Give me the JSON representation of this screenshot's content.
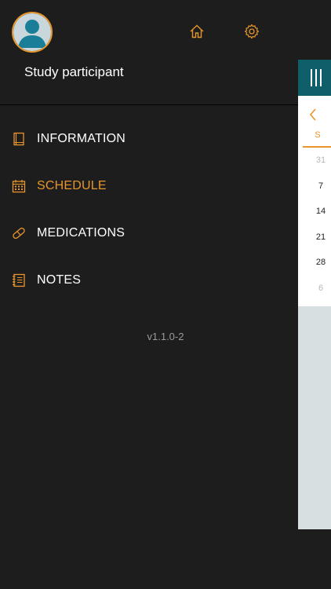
{
  "colors": {
    "accent": "#e8952b",
    "background": "#1d1d1d",
    "calendar_header": "#0f5f6b"
  },
  "header": {
    "avatar_icon": "user-avatar-icon",
    "home_icon": "home-icon",
    "settings_icon": "gear-icon",
    "username": "Study participant"
  },
  "menu": {
    "items": [
      {
        "label": "INFORMATION",
        "icon": "book-icon",
        "active": false
      },
      {
        "label": "SCHEDULE",
        "icon": "calendar-icon",
        "active": true
      },
      {
        "label": "MEDICATIONS",
        "icon": "pill-icon",
        "active": false
      },
      {
        "label": "NOTES",
        "icon": "notepad-icon",
        "active": false
      }
    ]
  },
  "version": "v1.1.0-2",
  "calendar_peek": {
    "back_icon": "chevron-left-icon",
    "menu_icon": "menu-bars-icon",
    "day_letter": "S",
    "dates": [
      "31",
      "7",
      "14",
      "21",
      "28",
      "6"
    ]
  }
}
